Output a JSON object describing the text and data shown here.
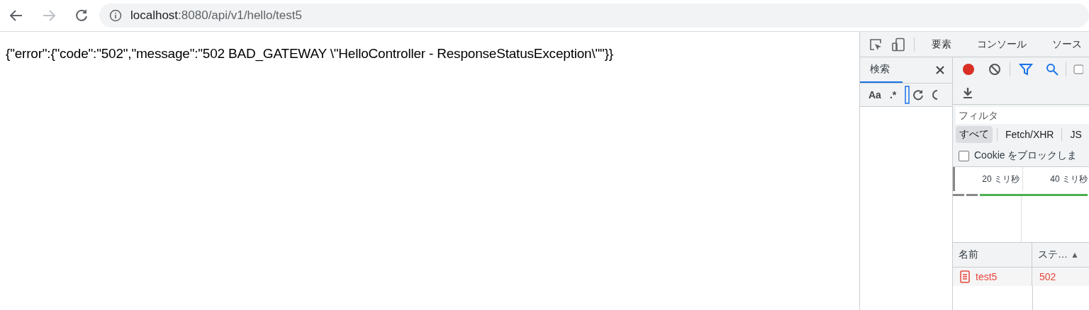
{
  "toolbar": {
    "url_host": "localhost",
    "url_path": ":8080/api/v1/hello/test5"
  },
  "page": {
    "body": "{\"error\":{\"code\":\"502\",\"message\":\"502 BAD_GATEWAY \\\"HelloController - ResponseStatusException\\\"\"}}"
  },
  "devtools": {
    "tabs": [
      {
        "label": "要素",
        "selected": false
      },
      {
        "label": "コンソール",
        "selected": false
      },
      {
        "label": "ソース",
        "selected": false
      }
    ],
    "search_panel": {
      "tab": "検索",
      "options": [
        "Aa",
        ".*"
      ]
    },
    "network": {
      "recording": true,
      "filter_placeholder": "フィルタ",
      "type_filters": [
        {
          "label": "すべて",
          "selected": true
        },
        {
          "label": "Fetch/XHR",
          "selected": false
        },
        {
          "label": "JS",
          "selected": false
        }
      ],
      "block_cookies": {
        "label": "Cookie をブロックしま",
        "checked": false
      },
      "timeline_ticks": [
        "20 ミリ秒",
        "40 ミリ秒"
      ],
      "columns": [
        {
          "label": "名前"
        },
        {
          "label": "ステ…",
          "sort": "▲"
        }
      ],
      "rows": [
        {
          "name": "test5",
          "status": "502",
          "failed": true
        }
      ]
    }
  }
}
